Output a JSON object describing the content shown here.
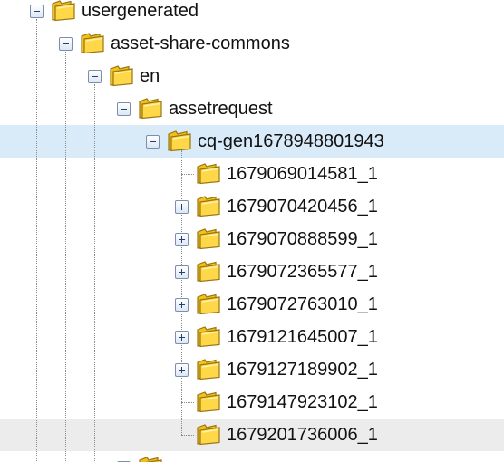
{
  "tree": {
    "nodes": [
      {
        "label": "usergenerated",
        "depth": 0,
        "toggle": "minus",
        "state": "normal"
      },
      {
        "label": "asset-share-commons",
        "depth": 1,
        "toggle": "minus",
        "state": "normal"
      },
      {
        "label": "en",
        "depth": 2,
        "toggle": "minus",
        "state": "normal"
      },
      {
        "label": "assetrequest",
        "depth": 3,
        "toggle": "minus",
        "state": "normal"
      },
      {
        "label": "cq-gen1678948801943",
        "depth": 4,
        "toggle": "minus",
        "state": "selected"
      },
      {
        "label": "1679069014581_1",
        "depth": 5,
        "toggle": "none",
        "state": "normal"
      },
      {
        "label": "1679070420456_1",
        "depth": 5,
        "toggle": "plus",
        "state": "normal"
      },
      {
        "label": "1679070888599_1",
        "depth": 5,
        "toggle": "plus",
        "state": "normal"
      },
      {
        "label": "1679072365577_1",
        "depth": 5,
        "toggle": "plus",
        "state": "normal"
      },
      {
        "label": "1679072763010_1",
        "depth": 5,
        "toggle": "plus",
        "state": "normal"
      },
      {
        "label": "1679121645007_1",
        "depth": 5,
        "toggle": "plus",
        "state": "normal"
      },
      {
        "label": "1679127189902_1",
        "depth": 5,
        "toggle": "plus",
        "state": "normal"
      },
      {
        "label": "1679147923102_1",
        "depth": 5,
        "toggle": "none",
        "state": "normal"
      },
      {
        "label": "1679201736006_1",
        "depth": 5,
        "toggle": "none",
        "state": "hover"
      },
      {
        "label": "",
        "depth": 3,
        "toggle": "minus",
        "state": "normal"
      }
    ]
  },
  "colors": {
    "selected_bg": "#d9ebf9",
    "hover_bg": "#ececec",
    "folder_fill": "#f2c21b",
    "folder_edge": "#9a7410",
    "toggle_border": "#7a8fb0",
    "connector": "#8a8a8a"
  },
  "icons": {
    "folder": "folder-icon",
    "expanded": "collapse-toggle-icon",
    "collapsed": "expand-toggle-icon"
  }
}
